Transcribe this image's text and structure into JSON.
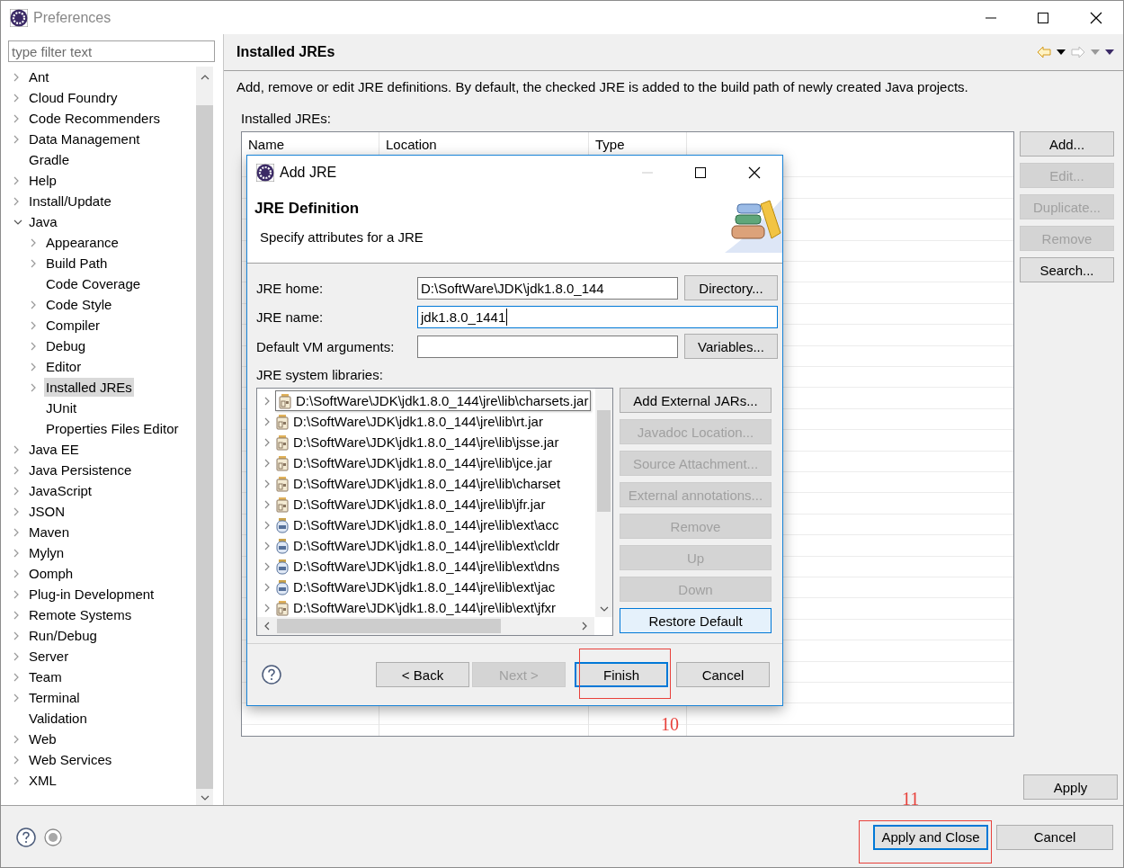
{
  "window": {
    "title": "Preferences"
  },
  "filter": {
    "placeholder": "type filter text"
  },
  "tree": [
    {
      "label": "Ant",
      "expanded": false,
      "selected": false
    },
    {
      "label": "Cloud Foundry",
      "expanded": false,
      "selected": false
    },
    {
      "label": "Code Recommenders",
      "expanded": false,
      "selected": false
    },
    {
      "label": "Data Management",
      "expanded": false,
      "selected": false
    },
    {
      "label": "Gradle",
      "selected": false
    },
    {
      "label": "Help",
      "expanded": false,
      "selected": false
    },
    {
      "label": "Install/Update",
      "expanded": false,
      "selected": false
    },
    {
      "label": "Java",
      "expanded": true,
      "selected": false,
      "children": [
        {
          "label": "Appearance",
          "expanded": false,
          "selected": false
        },
        {
          "label": "Build Path",
          "expanded": false,
          "selected": false
        },
        {
          "label": "Code Coverage",
          "selected": false
        },
        {
          "label": "Code Style",
          "expanded": false,
          "selected": false
        },
        {
          "label": "Compiler",
          "expanded": false,
          "selected": false
        },
        {
          "label": "Debug",
          "expanded": false,
          "selected": false
        },
        {
          "label": "Editor",
          "expanded": false,
          "selected": false
        },
        {
          "label": "Installed JREs",
          "expanded": false,
          "selected": true
        },
        {
          "label": "JUnit",
          "selected": false
        },
        {
          "label": "Properties Files Editor",
          "selected": false
        }
      ]
    },
    {
      "label": "Java EE",
      "expanded": false,
      "selected": false
    },
    {
      "label": "Java Persistence",
      "expanded": false,
      "selected": false
    },
    {
      "label": "JavaScript",
      "expanded": false,
      "selected": false
    },
    {
      "label": "JSON",
      "expanded": false,
      "selected": false
    },
    {
      "label": "Maven",
      "expanded": false,
      "selected": false
    },
    {
      "label": "Mylyn",
      "expanded": false,
      "selected": false
    },
    {
      "label": "Oomph",
      "expanded": false,
      "selected": false
    },
    {
      "label": "Plug-in Development",
      "expanded": false,
      "selected": false
    },
    {
      "label": "Remote Systems",
      "expanded": false,
      "selected": false
    },
    {
      "label": "Run/Debug",
      "expanded": false,
      "selected": false
    },
    {
      "label": "Server",
      "expanded": false,
      "selected": false
    },
    {
      "label": "Team",
      "expanded": false,
      "selected": false
    },
    {
      "label": "Terminal",
      "expanded": false,
      "selected": false
    },
    {
      "label": "Validation",
      "selected": false
    },
    {
      "label": "Web",
      "expanded": false,
      "selected": false
    },
    {
      "label": "Web Services",
      "expanded": false,
      "selected": false
    },
    {
      "label": "XML",
      "expanded": false,
      "selected": false
    }
  ],
  "page": {
    "title": "Installed JREs",
    "history": {
      "back_enabled": true,
      "forward_enabled": false
    },
    "description": "Add, remove or edit JRE definitions. By default, the checked JRE is added to the build path of newly created Java projects.",
    "table_label": "Installed JREs:",
    "table": {
      "columns": [
        "Name",
        "Location",
        "Type"
      ]
    },
    "buttons": [
      {
        "label": "Add...",
        "disabled": false
      },
      {
        "label": "Edit...",
        "disabled": true
      },
      {
        "label": "Duplicate...",
        "disabled": true
      },
      {
        "label": "Remove",
        "disabled": true
      },
      {
        "label": "Search...",
        "disabled": false
      }
    ],
    "apply": "Apply"
  },
  "footer": {
    "buttons": [
      {
        "label": "Apply and Close",
        "default": true
      },
      {
        "label": "Cancel",
        "default": false
      }
    ]
  },
  "dialog": {
    "title": "Add JRE",
    "heading": "JRE Definition",
    "subheading": "Specify attributes for a JRE",
    "fields": [
      {
        "label": "JRE home:",
        "value": "D:\\SoftWare\\JDK\\jdk1.8.0_144",
        "focused": false,
        "button": "Directory..."
      },
      {
        "label": "JRE name:",
        "value": "jdk1.8.0_1441",
        "focused": true
      },
      {
        "label": "Default VM arguments:",
        "focused": false,
        "button": "Variables..."
      }
    ],
    "libraries_label": "JRE system libraries:",
    "libraries": [
      {
        "path": "D:\\SoftWare\\JDK\\jdk1.8.0_144\\jre\\lib\\charsets.jar",
        "kind": "jar",
        "hovered": true
      },
      {
        "path": "D:\\SoftWare\\JDK\\jdk1.8.0_144\\jre\\lib\\rt.jar",
        "kind": "jar",
        "hovered": false
      },
      {
        "path": "D:\\SoftWare\\JDK\\jdk1.8.0_144\\jre\\lib\\jsse.jar",
        "kind": "jar",
        "hovered": false
      },
      {
        "path": "D:\\SoftWare\\JDK\\jdk1.8.0_144\\jre\\lib\\jce.jar",
        "kind": "jar",
        "hovered": false
      },
      {
        "path": "D:\\SoftWare\\JDK\\jdk1.8.0_144\\jre\\lib\\charset",
        "kind": "jar",
        "hovered": false
      },
      {
        "path": "D:\\SoftWare\\JDK\\jdk1.8.0_144\\jre\\lib\\jfr.jar",
        "kind": "jar",
        "hovered": false
      },
      {
        "path": "D:\\SoftWare\\JDK\\jdk1.8.0_144\\jre\\lib\\ext\\acc",
        "kind": "ext",
        "hovered": false
      },
      {
        "path": "D:\\SoftWare\\JDK\\jdk1.8.0_144\\jre\\lib\\ext\\cldr",
        "kind": "ext",
        "hovered": false
      },
      {
        "path": "D:\\SoftWare\\JDK\\jdk1.8.0_144\\jre\\lib\\ext\\dns",
        "kind": "ext",
        "hovered": false
      },
      {
        "path": "D:\\SoftWare\\JDK\\jdk1.8.0_144\\jre\\lib\\ext\\jac",
        "kind": "ext",
        "hovered": false
      },
      {
        "path": "D:\\SoftWare\\JDK\\jdk1.8.0_144\\jre\\lib\\ext\\jfxr",
        "kind": "jar",
        "hovered": false
      }
    ],
    "library_buttons": [
      {
        "label": "Add External JARs...",
        "disabled": false,
        "hovered": false
      },
      {
        "label": "Javadoc Location...",
        "disabled": true,
        "hovered": false
      },
      {
        "label": "Source Attachment...",
        "disabled": true,
        "hovered": false
      },
      {
        "label": "External annotations...",
        "disabled": true,
        "hovered": false
      },
      {
        "label": "Remove",
        "disabled": true,
        "hovered": false
      },
      {
        "label": "Up",
        "disabled": true,
        "hovered": false
      },
      {
        "label": "Down",
        "disabled": true,
        "hovered": false
      },
      {
        "label": "Restore Default",
        "disabled": false,
        "hovered": true
      }
    ],
    "buttons": [
      {
        "label": "< Back",
        "disabled": false,
        "default": false
      },
      {
        "label": "Next >",
        "disabled": true,
        "default": false
      },
      {
        "label": "Finish",
        "disabled": false,
        "default": true
      },
      {
        "label": "Cancel",
        "disabled": false,
        "default": false
      }
    ]
  },
  "annotations": [
    {
      "label": "10"
    },
    {
      "label": "11"
    }
  ]
}
